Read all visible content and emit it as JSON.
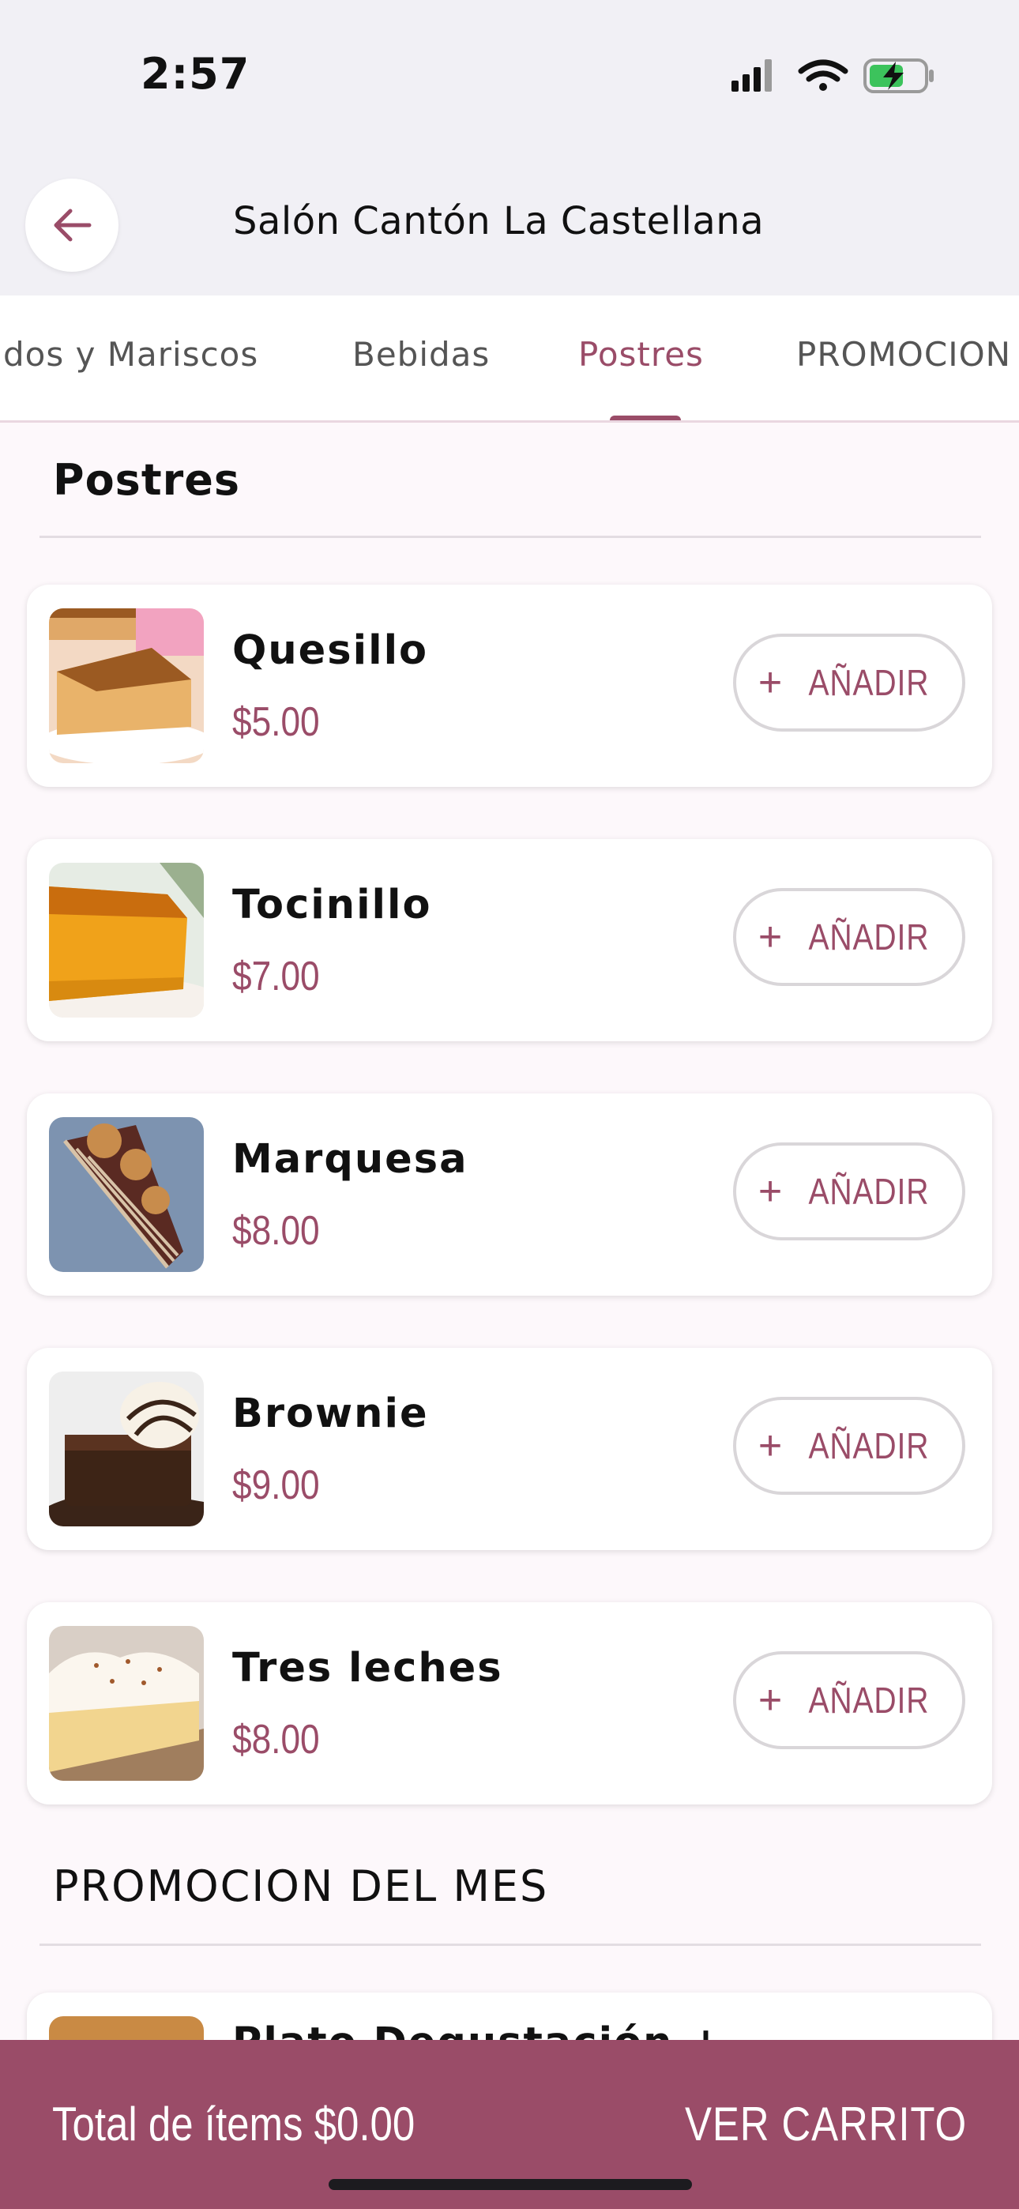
{
  "status_bar": {
    "time": "2:57"
  },
  "header": {
    "title": "Salón Cantón La Castellana"
  },
  "tabs": [
    {
      "label": "dos y Mariscos"
    },
    {
      "label": "Bebidas"
    },
    {
      "label": "Postres"
    },
    {
      "label": "PROMOCION"
    }
  ],
  "active_tab": "Postres",
  "colors": {
    "accent": "#9a4c68",
    "background": "#fdf8fb"
  },
  "sections": {
    "postres": {
      "title": "Postres",
      "items": [
        {
          "name": "Quesillo",
          "price": "$5.00",
          "add_label": "AÑADIR",
          "image": "flan-icon"
        },
        {
          "name": "Tocinillo",
          "price": "$7.00",
          "add_label": "AÑADIR",
          "image": "tocinillo-icon"
        },
        {
          "name": "Marquesa",
          "price": "$8.00",
          "add_label": "AÑADIR",
          "image": "cake-slice-icon"
        },
        {
          "name": "Brownie",
          "price": "$9.00",
          "add_label": "AÑADIR",
          "image": "brownie-icon"
        },
        {
          "name": "Tres leches",
          "price": "$8.00",
          "add_label": "AÑADIR",
          "image": "tres-leches-icon"
        }
      ]
    },
    "promocion": {
      "title": "PROMOCION DEL MES",
      "items": [
        {
          "name": "Plato Degustación +"
        }
      ]
    }
  },
  "cart": {
    "total_text": "Total de ítems $0.00",
    "view_cart_label": "VER CARRITO"
  }
}
